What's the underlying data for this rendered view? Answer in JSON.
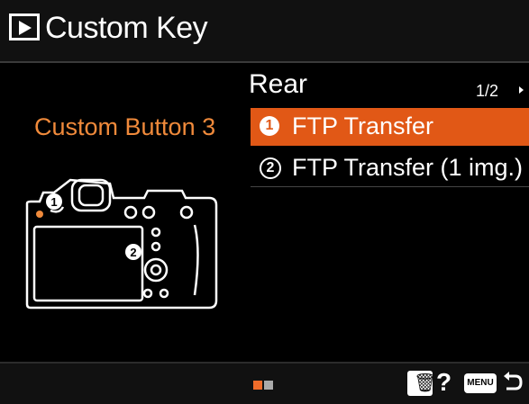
{
  "header": {
    "title": "Custom Key",
    "icon": "playback-icon"
  },
  "menu": {
    "section": "Rear",
    "page": "1/2",
    "button_name": "Custom Button 3",
    "items": [
      {
        "number": "1",
        "label": "FTP Transfer",
        "selected": true
      },
      {
        "number": "2",
        "label": "FTP Transfer (1 img.)",
        "selected": false
      }
    ]
  },
  "illustration": {
    "markers": [
      "1",
      "2"
    ]
  },
  "footer": {
    "pages": 2,
    "current_page": 1,
    "help": "?",
    "menu_label": "MENU"
  },
  "colors": {
    "accent": "#e15816",
    "button_name": "#f08a3b"
  }
}
